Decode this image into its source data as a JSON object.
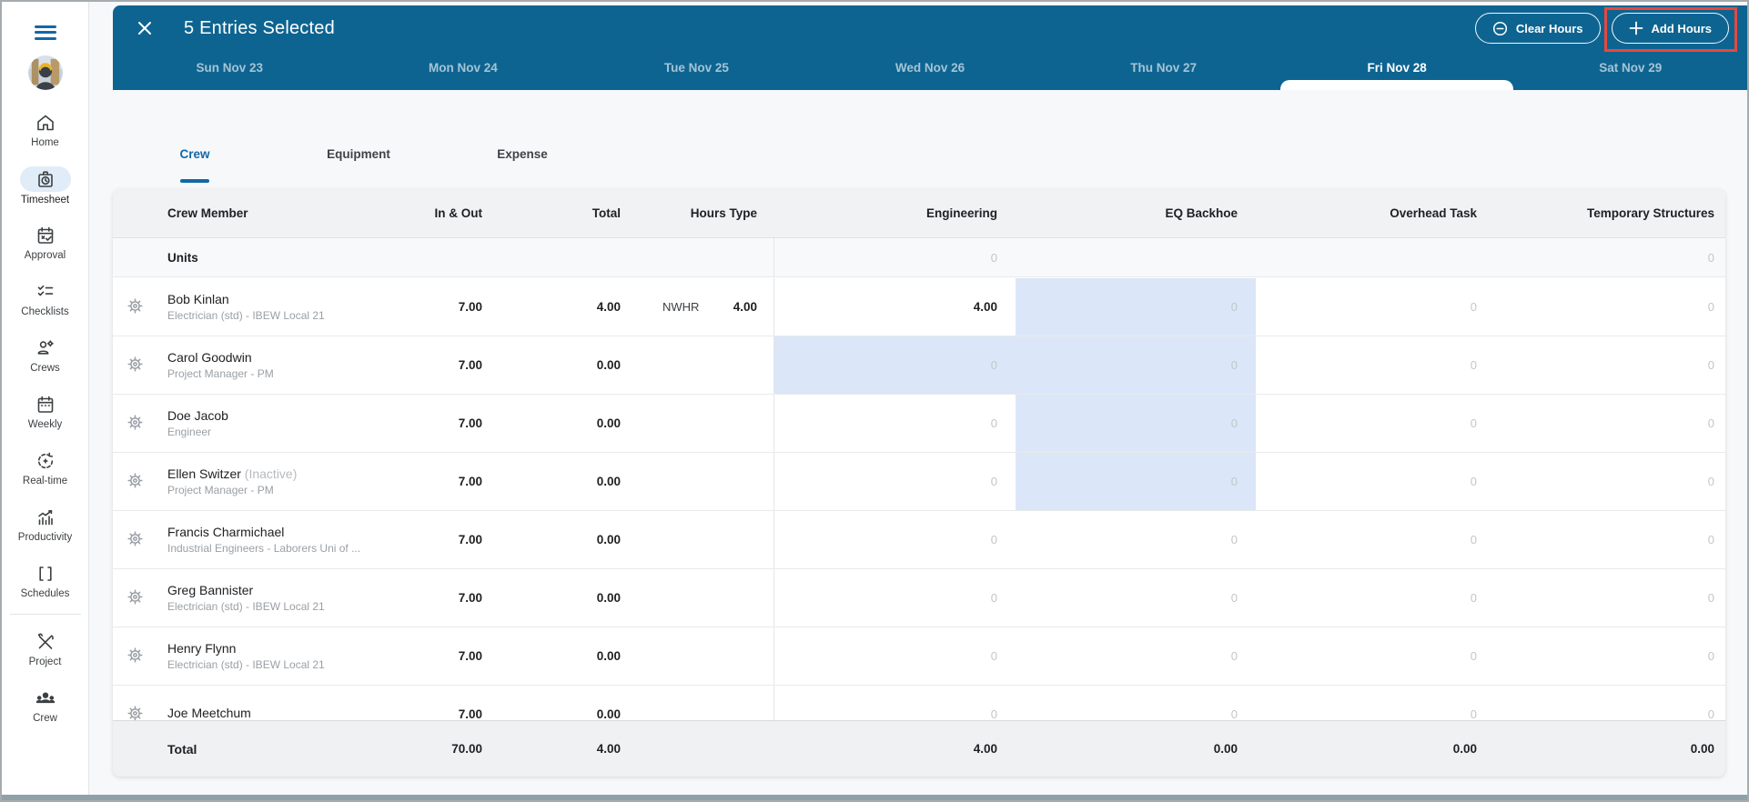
{
  "colors": {
    "header": "#0e6491",
    "accent": "#1268a5",
    "selection": "#dbe7f8",
    "annotation": "#e6483d"
  },
  "sidebar": {
    "items": [
      {
        "label": "Home",
        "icon": "home-icon",
        "active": false
      },
      {
        "label": "Timesheet",
        "icon": "timesheet-icon",
        "active": true
      },
      {
        "label": "Approval",
        "icon": "approval-icon",
        "active": false
      },
      {
        "label": "Checklists",
        "icon": "checklists-icon",
        "active": false
      },
      {
        "label": "Crews",
        "icon": "crews-icon",
        "active": false
      },
      {
        "label": "Weekly",
        "icon": "weekly-icon",
        "active": false
      },
      {
        "label": "Real-time",
        "icon": "realtime-icon",
        "active": false
      },
      {
        "label": "Productivity",
        "icon": "productivity-icon",
        "active": false
      },
      {
        "label": "Schedules",
        "icon": "schedules-icon",
        "active": false,
        "divider_after": true
      },
      {
        "label": "Project",
        "icon": "project-icon",
        "active": false
      },
      {
        "label": "Crew",
        "icon": "crew-icon",
        "active": false
      }
    ]
  },
  "header": {
    "title": "5 Entries Selected",
    "actions": [
      {
        "label": "Clear Hours",
        "icon": "minus-circle-icon",
        "highlighted": false
      },
      {
        "label": "Add Hours",
        "icon": "plus-icon",
        "highlighted": true
      }
    ],
    "days": [
      {
        "label": "Sun Nov 23",
        "active": false
      },
      {
        "label": "Mon Nov 24",
        "active": false
      },
      {
        "label": "Tue Nov 25",
        "active": false
      },
      {
        "label": "Wed Nov 26",
        "active": false
      },
      {
        "label": "Thu Nov 27",
        "active": false
      },
      {
        "label": "Fri Nov 28",
        "active": true
      },
      {
        "label": "Sat Nov 29",
        "active": false
      }
    ]
  },
  "sheet_tabs": [
    {
      "label": "Crew",
      "active": true
    },
    {
      "label": "Equipment",
      "active": false
    },
    {
      "label": "Expense",
      "active": false
    }
  ],
  "table": {
    "columns": [
      "Crew Member",
      "In & Out",
      "Total",
      "Hours Type",
      "Engineering",
      "EQ Backhoe",
      "Overhead Task",
      "Temporary Structures"
    ],
    "units_row": {
      "label": "Units",
      "engineering": "0",
      "temporary_structures": "0"
    },
    "rows": [
      {
        "name": "Bob Kinlan",
        "suffix": "",
        "role": "Electrician (std) - IBEW Local 21",
        "in_out": "7.00",
        "total": "4.00",
        "ht_label": "NWHR",
        "ht_value": "4.00",
        "eng": "4.00",
        "eq": "0",
        "oh": "0",
        "ts": "0",
        "selected": [
          "eq"
        ]
      },
      {
        "name": "Carol Goodwin",
        "suffix": "",
        "role": "Project Manager - PM",
        "in_out": "7.00",
        "total": "0.00",
        "ht_label": "",
        "ht_value": "",
        "eng": "0",
        "eq": "0",
        "oh": "0",
        "ts": "0",
        "selected": [
          "eng",
          "eq"
        ]
      },
      {
        "name": "Doe Jacob",
        "suffix": "",
        "role": "Engineer",
        "in_out": "7.00",
        "total": "0.00",
        "ht_label": "",
        "ht_value": "",
        "eng": "0",
        "eq": "0",
        "oh": "0",
        "ts": "0",
        "selected": [
          "eq"
        ]
      },
      {
        "name": "Ellen Switzer",
        "suffix": " (Inactive)",
        "role": "Project Manager - PM",
        "in_out": "7.00",
        "total": "0.00",
        "ht_label": "",
        "ht_value": "",
        "eng": "0",
        "eq": "0",
        "oh": "0",
        "ts": "0",
        "selected": [
          "eq"
        ]
      },
      {
        "name": "Francis Charmichael",
        "suffix": "",
        "role": "Industrial Engineers - Laborers Uni of ...",
        "in_out": "7.00",
        "total": "0.00",
        "ht_label": "",
        "ht_value": "",
        "eng": "0",
        "eq": "0",
        "oh": "0",
        "ts": "0",
        "selected": []
      },
      {
        "name": "Greg Bannister",
        "suffix": "",
        "role": "Electrician (std) - IBEW Local 21",
        "in_out": "7.00",
        "total": "0.00",
        "ht_label": "",
        "ht_value": "",
        "eng": "0",
        "eq": "0",
        "oh": "0",
        "ts": "0",
        "selected": []
      },
      {
        "name": "Henry Flynn",
        "suffix": "",
        "role": "Electrician (std) - IBEW Local 21",
        "in_out": "7.00",
        "total": "0.00",
        "ht_label": "",
        "ht_value": "",
        "eng": "0",
        "eq": "0",
        "oh": "0",
        "ts": "0",
        "selected": []
      },
      {
        "name": "Joe Meetchum",
        "suffix": "",
        "role": "",
        "in_out": "7.00",
        "total": "0.00",
        "ht_label": "",
        "ht_value": "",
        "eng": "0",
        "eq": "0",
        "oh": "0",
        "ts": "0",
        "selected": []
      }
    ],
    "total_row": {
      "label": "Total",
      "in_out": "70.00",
      "total": "4.00",
      "engineering": "4.00",
      "eq_backhoe": "0.00",
      "overhead_task": "0.00",
      "temporary_structures": "0.00"
    }
  }
}
